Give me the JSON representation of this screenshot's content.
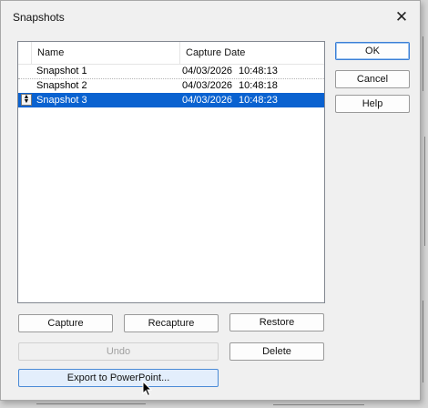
{
  "dialog": {
    "title": "Snapshots",
    "close_icon": "close-icon"
  },
  "list": {
    "columns": [
      "Name",
      "Capture Date"
    ],
    "rows": [
      {
        "name": "Snapshot 1",
        "date": "04/03/2026",
        "time": "10:48:13",
        "selected": false
      },
      {
        "name": "Snapshot 2",
        "date": "04/03/2026",
        "time": "10:48:18",
        "selected": false
      },
      {
        "name": "Snapshot 3",
        "date": "04/03/2026",
        "time": "10:48:23",
        "selected": true
      }
    ]
  },
  "buttons": {
    "ok": "OK",
    "cancel": "Cancel",
    "help": "Help",
    "capture": "Capture",
    "recapture": "Recapture",
    "restore": "Restore",
    "undo": "Undo",
    "delete": "Delete",
    "export": "Export to PowerPoint..."
  },
  "colors": {
    "selection": "#0a62d0",
    "default_button_border": "#3b7fd6"
  }
}
